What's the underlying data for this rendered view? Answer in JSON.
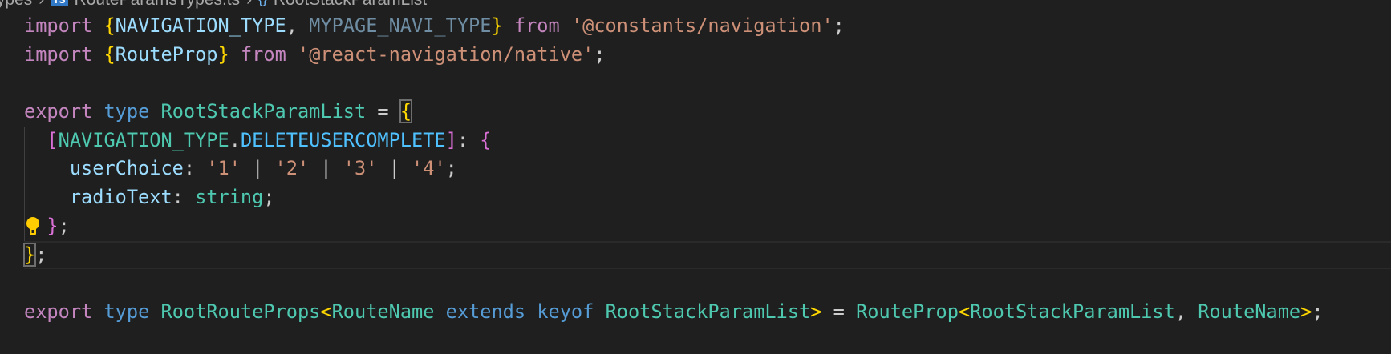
{
  "breadcrumb": {
    "folder": "types",
    "file_badge": "TS",
    "file": "RouteParamsTypes.ts",
    "symbol_icon": "{}",
    "symbol": "RootStackParamList",
    "separator": "›"
  },
  "editor": {
    "lines": [
      {
        "tokens": [
          {
            "t": "import",
            "c": "kw"
          },
          {
            "t": " ",
            "c": "punc"
          },
          {
            "t": "{",
            "c": "b1"
          },
          {
            "t": "NAVIGATION_TYPE",
            "c": "var"
          },
          {
            "t": ", ",
            "c": "punc"
          },
          {
            "t": "MYPAGE_NAVI_TYPE",
            "c": "dim"
          },
          {
            "t": "}",
            "c": "b1"
          },
          {
            "t": " ",
            "c": "punc"
          },
          {
            "t": "from",
            "c": "kw"
          },
          {
            "t": " ",
            "c": "punc"
          },
          {
            "t": "'@constants/navigation'",
            "c": "str"
          },
          {
            "t": ";",
            "c": "punc"
          }
        ]
      },
      {
        "tokens": [
          {
            "t": "import",
            "c": "kw"
          },
          {
            "t": " ",
            "c": "punc"
          },
          {
            "t": "{",
            "c": "b1"
          },
          {
            "t": "RouteProp",
            "c": "var"
          },
          {
            "t": "}",
            "c": "b1"
          },
          {
            "t": " ",
            "c": "punc"
          },
          {
            "t": "from",
            "c": "kw"
          },
          {
            "t": " ",
            "c": "punc"
          },
          {
            "t": "'@react-navigation/native'",
            "c": "str"
          },
          {
            "t": ";",
            "c": "punc"
          }
        ]
      },
      {
        "tokens": []
      },
      {
        "tokens": [
          {
            "t": "export",
            "c": "kw"
          },
          {
            "t": " ",
            "c": "punc"
          },
          {
            "t": "type",
            "c": "kw2"
          },
          {
            "t": " ",
            "c": "punc"
          },
          {
            "t": "RootStackParamList",
            "c": "type"
          },
          {
            "t": " = ",
            "c": "punc"
          },
          {
            "t": "{",
            "c": "b1 box"
          }
        ]
      },
      {
        "guide": true,
        "tokens": [
          {
            "t": "  ",
            "c": "punc"
          },
          {
            "t": "[",
            "c": "b2"
          },
          {
            "t": "NAVIGATION_TYPE",
            "c": "type"
          },
          {
            "t": ".",
            "c": "punc"
          },
          {
            "t": "DELETEUSERCOMPLETE",
            "c": "const"
          },
          {
            "t": "]",
            "c": "b2"
          },
          {
            "t": ": ",
            "c": "punc"
          },
          {
            "t": "{",
            "c": "b2"
          }
        ]
      },
      {
        "guide": true,
        "tokens": [
          {
            "t": "    ",
            "c": "punc"
          },
          {
            "t": "userChoice",
            "c": "var"
          },
          {
            "t": ": ",
            "c": "punc"
          },
          {
            "t": "'1'",
            "c": "str"
          },
          {
            "t": " | ",
            "c": "punc"
          },
          {
            "t": "'2'",
            "c": "str"
          },
          {
            "t": " | ",
            "c": "punc"
          },
          {
            "t": "'3'",
            "c": "str"
          },
          {
            "t": " | ",
            "c": "punc"
          },
          {
            "t": "'4'",
            "c": "str"
          },
          {
            "t": ";",
            "c": "punc"
          }
        ]
      },
      {
        "guide": true,
        "tokens": [
          {
            "t": "    ",
            "c": "punc"
          },
          {
            "t": "radioText",
            "c": "var"
          },
          {
            "t": ": ",
            "c": "punc"
          },
          {
            "t": "string",
            "c": "type"
          },
          {
            "t": ";",
            "c": "punc"
          }
        ]
      },
      {
        "guide": true,
        "bulb": true,
        "tokens": [
          {
            "t": "  ",
            "c": "punc"
          },
          {
            "t": "}",
            "c": "b2"
          },
          {
            "t": ";",
            "c": "punc"
          }
        ]
      },
      {
        "current": true,
        "tokens": [
          {
            "t": "}",
            "c": "b1 box"
          },
          {
            "t": ";",
            "c": "punc"
          }
        ]
      },
      {
        "tokens": []
      },
      {
        "tokens": [
          {
            "t": "export",
            "c": "kw"
          },
          {
            "t": " ",
            "c": "punc"
          },
          {
            "t": "type",
            "c": "kw2"
          },
          {
            "t": " ",
            "c": "punc"
          },
          {
            "t": "RootRouteProps",
            "c": "type"
          },
          {
            "t": "<",
            "c": "b1"
          },
          {
            "t": "RouteName",
            "c": "type"
          },
          {
            "t": " ",
            "c": "punc"
          },
          {
            "t": "extends",
            "c": "kw2"
          },
          {
            "t": " ",
            "c": "punc"
          },
          {
            "t": "keyof",
            "c": "kw2"
          },
          {
            "t": " ",
            "c": "punc"
          },
          {
            "t": "RootStackParamList",
            "c": "type"
          },
          {
            "t": ">",
            "c": "b1"
          },
          {
            "t": " = ",
            "c": "punc"
          },
          {
            "t": "RouteProp",
            "c": "type"
          },
          {
            "t": "<",
            "c": "b1"
          },
          {
            "t": "RootStackParamList",
            "c": "type"
          },
          {
            "t": ", ",
            "c": "punc"
          },
          {
            "t": "RouteName",
            "c": "type"
          },
          {
            "t": ">",
            "c": "b1"
          },
          {
            "t": ";",
            "c": "punc"
          }
        ]
      }
    ]
  }
}
